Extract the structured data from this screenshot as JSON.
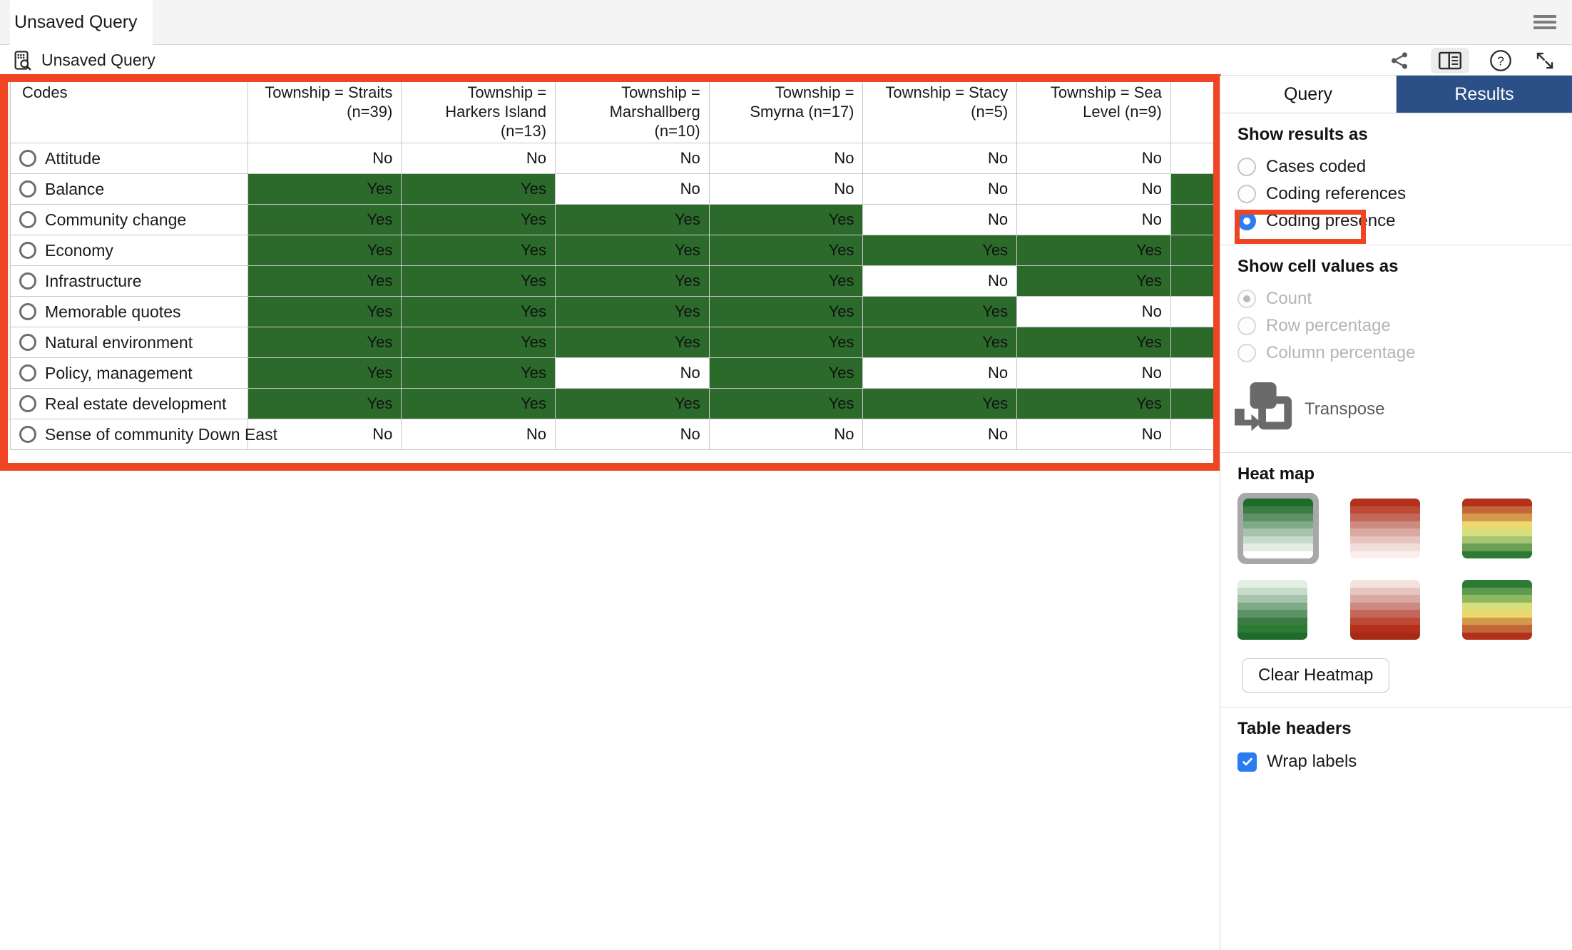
{
  "window": {
    "title": "Unsaved Query",
    "menu_icon": "hamburger-menu-icon"
  },
  "docbar": {
    "doc_icon": "query-document-icon",
    "doc_label": "Unsaved Query",
    "actions": [
      {
        "icon": "share-icon",
        "name": "share-button"
      },
      {
        "icon": "split-view-icon",
        "name": "split-view-button"
      },
      {
        "icon": "help-icon",
        "name": "help-button"
      },
      {
        "icon": "expand-diagonal-icon",
        "name": "expand-button"
      }
    ]
  },
  "table": {
    "columns": [
      "Codes",
      "Township = Straits (n=39)",
      "Township = Harkers Island (n=13)",
      "Township = Marshallberg (n=10)",
      "Township = Smyrna (n=17)",
      "Township = Stacy (n=5)",
      "Township = Sea Level (n=9)"
    ],
    "rows": [
      {
        "code": "Attitude",
        "values": [
          "No",
          "No",
          "No",
          "No",
          "No",
          "No"
        ],
        "pad": "white"
      },
      {
        "code": "Balance",
        "values": [
          "Yes",
          "Yes",
          "No",
          "No",
          "No",
          "No"
        ],
        "pad": "green"
      },
      {
        "code": "Community change",
        "values": [
          "Yes",
          "Yes",
          "Yes",
          "Yes",
          "No",
          "No"
        ],
        "pad": "green"
      },
      {
        "code": "Economy",
        "values": [
          "Yes",
          "Yes",
          "Yes",
          "Yes",
          "Yes",
          "Yes"
        ],
        "pad": "green"
      },
      {
        "code": "Infrastructure",
        "values": [
          "Yes",
          "Yes",
          "Yes",
          "Yes",
          "No",
          "Yes"
        ],
        "pad": "green"
      },
      {
        "code": "Memorable quotes",
        "values": [
          "Yes",
          "Yes",
          "Yes",
          "Yes",
          "Yes",
          "No"
        ],
        "pad": "white"
      },
      {
        "code": "Natural environment",
        "values": [
          "Yes",
          "Yes",
          "Yes",
          "Yes",
          "Yes",
          "Yes"
        ],
        "pad": "green"
      },
      {
        "code": "Policy, management",
        "values": [
          "Yes",
          "Yes",
          "No",
          "Yes",
          "No",
          "No"
        ],
        "pad": "white"
      },
      {
        "code": "Real estate development",
        "values": [
          "Yes",
          "Yes",
          "Yes",
          "Yes",
          "Yes",
          "Yes"
        ],
        "pad": "green"
      },
      {
        "code": "Sense of community Down East",
        "values": [
          "No",
          "No",
          "No",
          "No",
          "No",
          "No"
        ],
        "pad": "white"
      }
    ]
  },
  "panel": {
    "tabs": [
      {
        "label": "Query",
        "active": false
      },
      {
        "label": "Results",
        "active": true
      }
    ],
    "show_results_as": {
      "title": "Show results as",
      "options": [
        {
          "label": "Cases coded",
          "checked": false,
          "disabled": false,
          "highlighted": false
        },
        {
          "label": "Coding references",
          "checked": false,
          "disabled": false,
          "highlighted": false
        },
        {
          "label": "Coding presence",
          "checked": true,
          "disabled": false,
          "highlighted": true
        }
      ]
    },
    "show_cell_values_as": {
      "title": "Show cell values as",
      "options": [
        {
          "label": "Count",
          "checked": true,
          "disabled": true
        },
        {
          "label": "Row percentage",
          "checked": false,
          "disabled": true
        },
        {
          "label": "Column percentage",
          "checked": false,
          "disabled": true
        }
      ]
    },
    "transpose": {
      "label": "Transpose",
      "icon": "transpose-icon"
    },
    "heatmap": {
      "title": "Heat map",
      "clear_label": "Clear Heatmap",
      "swatches": [
        {
          "name": "green-descending",
          "selected": true,
          "colors": [
            "#1f6b2b",
            "#3a7c44",
            "#5d9167",
            "#7faa88",
            "#a6c4ab",
            "#c6dbca",
            "#e3eee5",
            "#ffffff"
          ]
        },
        {
          "name": "red-descending",
          "selected": false,
          "colors": [
            "#b3311c",
            "#bc4a35",
            "#c2675a",
            "#cd8a80",
            "#daa9a2",
            "#e6c5c0",
            "#f1dedb",
            "#fbeeec"
          ]
        },
        {
          "name": "red-to-green",
          "selected": false,
          "colors": [
            "#b3301b",
            "#c3663a",
            "#d39a4c",
            "#ecd86f",
            "#d7e07c",
            "#a7c474",
            "#6ba055",
            "#2c7a33"
          ]
        },
        {
          "name": "green-ascending",
          "selected": false,
          "colors": [
            "#e3eee5",
            "#c6dbca",
            "#a6c4ab",
            "#7faa88",
            "#5d9167",
            "#3a7c44",
            "#2c7a33",
            "#1f6b2b"
          ]
        },
        {
          "name": "red-ascending",
          "selected": false,
          "colors": [
            "#f5e2df",
            "#e6c5c0",
            "#daa9a2",
            "#cd8a80",
            "#c2675a",
            "#bc4a35",
            "#b3311c",
            "#a62a16"
          ]
        },
        {
          "name": "green-to-red",
          "selected": false,
          "colors": [
            "#2c7a33",
            "#5d9b51",
            "#8fb85f",
            "#d7e07c",
            "#ecd86f",
            "#d39a4c",
            "#c3663a",
            "#b3301b"
          ]
        }
      ]
    },
    "table_headers": {
      "title": "Table headers",
      "wrap_labels": {
        "label": "Wrap labels",
        "checked": true
      }
    }
  },
  "colors": {
    "annotation": "#ef4523",
    "cell_yes_bg": "#2c6a2c",
    "tab_active_bg": "#2b4f87",
    "radio_checked": "#2b7cf0"
  }
}
